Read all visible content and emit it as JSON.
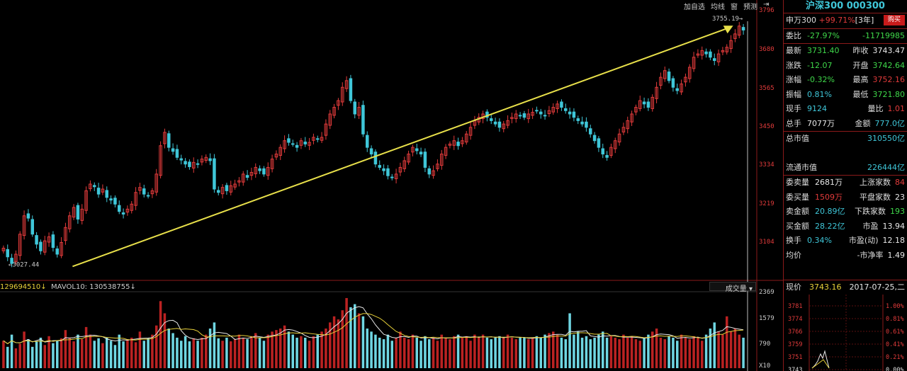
{
  "toolbar": {
    "items": [
      "加自选",
      "均线",
      "窗",
      "预测",
      "⇥"
    ]
  },
  "chart": {
    "high_marker": "3755.19",
    "low_marker": "3027.44",
    "price_axis": [
      "3796",
      "3680",
      "3565",
      "3450",
      "3334",
      "3219",
      "3104"
    ],
    "volume_axis": [
      "2369",
      "1579",
      "790",
      "X10"
    ]
  },
  "volume_header": {
    "val1": "129694510",
    "label2": "MAVOL10: 130538755",
    "select_label": "成交量"
  },
  "chart_data": {
    "type": "candlestick",
    "ylim": [
      2990,
      3796
    ],
    "volume_ylim": [
      0,
      2369
    ],
    "trendline": {
      "from": 3027.44,
      "to": 3755.19
    },
    "closes": [
      3078,
      3052,
      3032,
      3060,
      3120,
      3175,
      3168,
      3120,
      3090,
      3070,
      3100,
      3112,
      3080,
      3060,
      3095,
      3140,
      3175,
      3200,
      3165,
      3195,
      3250,
      3270,
      3262,
      3240,
      3255,
      3230,
      3222,
      3210,
      3188,
      3180,
      3195,
      3210,
      3245,
      3260,
      3240,
      3235,
      3250,
      3300,
      3385,
      3425,
      3380,
      3368,
      3350,
      3342,
      3330,
      3322,
      3335,
      3330,
      3345,
      3350,
      3340,
      3255,
      3245,
      3260,
      3250,
      3265,
      3270,
      3280,
      3300,
      3290,
      3305,
      3320,
      3310,
      3300,
      3320,
      3345,
      3360,
      3380,
      3400,
      3395,
      3390,
      3380,
      3400,
      3390,
      3395,
      3410,
      3405,
      3410,
      3450,
      3480,
      3500,
      3520,
      3560,
      3580,
      3520,
      3480,
      3500,
      3420,
      3380,
      3360,
      3330,
      3320,
      3310,
      3295,
      3290,
      3300,
      3320,
      3340,
      3360,
      3380,
      3370,
      3360,
      3320,
      3300,
      3310,
      3330,
      3360,
      3380,
      3390,
      3400,
      3385,
      3400,
      3420,
      3440,
      3460,
      3470,
      3480,
      3470,
      3460,
      3450,
      3440,
      3450,
      3460,
      3470,
      3480,
      3475,
      3470,
      3480,
      3485,
      3490,
      3480,
      3475,
      3490,
      3500,
      3510,
      3500,
      3490,
      3480,
      3470,
      3460,
      3450,
      3440,
      3420,
      3400,
      3380,
      3360,
      3350,
      3380,
      3400,
      3420,
      3440,
      3460,
      3480,
      3500,
      3520,
      3510,
      3500,
      3530,
      3560,
      3590,
      3610,
      3580,
      3560,
      3550,
      3570,
      3590,
      3620,
      3650,
      3660,
      3670,
      3660,
      3650,
      3640,
      3660,
      3670,
      3680,
      3700,
      3720,
      3743.47,
      3731.4
    ],
    "volumes": [
      900,
      700,
      1100,
      650,
      800,
      1200,
      950,
      700,
      880,
      1000,
      760,
      1050,
      820,
      900,
      980,
      1250,
      1000,
      880,
      1100,
      950,
      1350,
      1100,
      900,
      980,
      820,
      1000,
      900,
      760,
      1100,
      880,
      950,
      1000,
      850,
      1200,
      900,
      980,
      1100,
      1400,
      2200,
      1800,
      1300,
      1150,
      1000,
      900,
      1050,
      880,
      980,
      900,
      1000,
      1100,
      1300,
      1500,
      980,
      900,
      1000,
      880,
      950,
      1100,
      1000,
      950,
      1050,
      1150,
      1000,
      900,
      1100,
      1200,
      1250,
      1300,
      1400,
      1200,
      1100,
      1000,
      1050,
      1000,
      900,
      1050,
      1100,
      1200,
      1300,
      1500,
      1700,
      1600,
      1900,
      2300,
      2000,
      2100,
      1800,
      1700,
      1300,
      1200,
      1100,
      1000,
      950,
      1100,
      900,
      1000,
      1200,
      1000,
      950,
      1100,
      1000,
      900,
      1050,
      950,
      1000,
      900,
      1100,
      1000,
      950,
      1050,
      1100,
      1000,
      1050,
      900,
      1100,
      1000,
      1100,
      1000,
      950,
      1000,
      1050,
      1000,
      1100,
      1000,
      950,
      1000,
      1000,
      950,
      1000,
      1050,
      1000,
      1100,
      1150,
      1200,
      1100,
      1000,
      950,
      1800,
      1100,
      1200,
      1000,
      1050,
      950,
      1000,
      1100,
      1200,
      1000,
      1050,
      1000,
      950,
      1100,
      1000,
      1050,
      950,
      900,
      1000,
      1100,
      1200,
      1300,
      1000,
      950,
      1050,
      1000,
      900,
      1100,
      1000,
      950,
      1050,
      1000,
      900,
      1100,
      1300,
      1500,
      1200,
      1100,
      1700,
      1200,
      1300,
      1100,
      1000
    ]
  },
  "panel": {
    "title": "沪深300 000300",
    "sw_label": "申万300",
    "sw_change": "+99.71%",
    "sw_period": "[3年]",
    "buy_label": "购买",
    "rows1": [
      {
        "l": "委比",
        "v": "-27.97%",
        "vc": "green",
        "l2": "",
        "v2": "-11719985",
        "v2c": "green"
      }
    ],
    "rows2": [
      {
        "l": "最新",
        "v": "3731.40",
        "vc": "green",
        "l2": "昨收",
        "v2": "3743.47",
        "v2c": "white"
      },
      {
        "l": "涨跌",
        "v": "-12.07",
        "vc": "green",
        "l2": "开盘",
        "v2": "3742.64",
        "v2c": "green"
      },
      {
        "l": "涨幅",
        "v": "-0.32%",
        "vc": "green",
        "l2": "最高",
        "v2": "3752.16",
        "v2c": "red"
      },
      {
        "l": "振幅",
        "v": "0.81%",
        "vc": "cyan",
        "l2": "最低",
        "v2": "3721.80",
        "v2c": "green"
      },
      {
        "l": "现手",
        "v": "9124",
        "vc": "cyan",
        "l2": "量比",
        "v2": "1.01",
        "v2c": "red"
      },
      {
        "l": "总手",
        "v": "7077万",
        "vc": "white",
        "l2": "金额",
        "v2": "777.0亿",
        "v2c": "cyan"
      }
    ],
    "market_value_label": "总市值",
    "market_value": "310550亿",
    "float_value_label": "流通市值",
    "float_value": "226444亿",
    "rows3": [
      {
        "l": "委卖量",
        "v": "2681万",
        "vc": "white",
        "l2": "上涨家数",
        "v2": "84",
        "v2c": "red"
      },
      {
        "l": "委买量",
        "v": "1509万",
        "vc": "red",
        "l2": "平盘家数",
        "v2": "23",
        "v2c": "white"
      },
      {
        "l": "卖金额",
        "v": "20.89亿",
        "vc": "cyan",
        "l2": "下跌家数",
        "v2": "193",
        "v2c": "green"
      },
      {
        "l": "买金额",
        "v": "28.22亿",
        "vc": "cyan",
        "l2": "市盈",
        "v2": "13.94",
        "v2c": "white"
      },
      {
        "l": "换手",
        "v": "0.34%",
        "vc": "cyan",
        "l2": "市盈(动)",
        "v2": "12.18",
        "v2c": "white"
      },
      {
        "l": "均价",
        "v": "",
        "vc": "white",
        "l2": "-市净率",
        "v2": "1.49",
        "v2c": "white"
      }
    ],
    "intraday_label": "现价",
    "intraday_price": "3743.16",
    "intraday_date": "2017-07-25,二",
    "mini_left": [
      "3781",
      "3774",
      "3766",
      "3759",
      "3751",
      "3743"
    ],
    "mini_right": [
      "1.00%",
      "0.81%",
      "0.61%",
      "0.41%",
      "0.21%",
      "0.00%"
    ]
  }
}
